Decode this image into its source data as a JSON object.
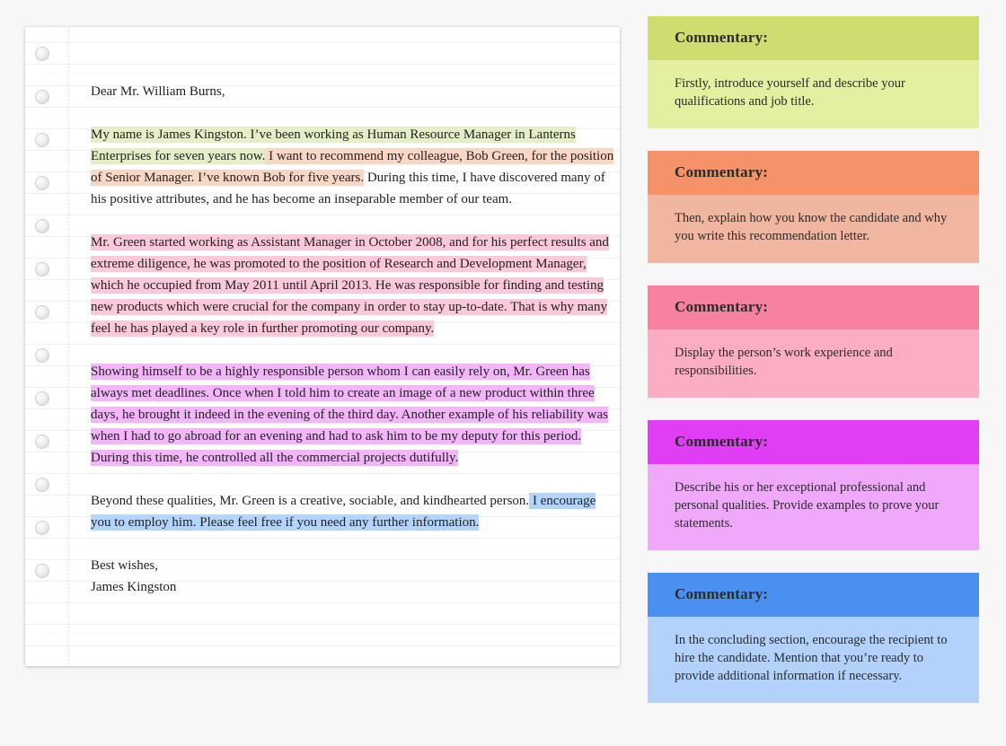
{
  "page": {
    "background": "#f7f7f8"
  },
  "paper": {
    "margin_rule_color": "#e2e2e2",
    "rule_color": "#eaf3f1",
    "hole_count": 13
  },
  "letter": {
    "salutation": "Dear Mr. William Burns,",
    "closing": "Best wishes,",
    "signature": "James Kingston",
    "lines": [
      {
        "line": 1,
        "segments": [
          {
            "text": "My name is James Kingston. I’ve been working as Human Resource Manager in Lanterns",
            "highlight": "green"
          }
        ]
      },
      {
        "line": 2,
        "segments": [
          {
            "text": "Enterprises for seven years now.",
            "highlight": "green"
          },
          {
            "text": " I want to recommend my colleague, Bob Green, for the position",
            "highlight": "peach"
          }
        ]
      },
      {
        "line": 3,
        "segments": [
          {
            "text": "of Senior Manager. I’ve known Bob for five years.",
            "highlight": "peach"
          },
          {
            "text": " During this time, I have discovered many of",
            "highlight": "none"
          }
        ]
      },
      {
        "line": 4,
        "segments": [
          {
            "text": "his positive attributes, and he has become an inseparable member of our team.",
            "highlight": "none"
          }
        ]
      },
      {
        "line": 5,
        "segments": [
          {
            "text": "Mr. Green started working as Assistant Manager in October 2008, and for his perfect results and",
            "highlight": "pink"
          }
        ]
      },
      {
        "line": 6,
        "segments": [
          {
            "text": "extreme diligence, he was promoted to the position of Research and Development Manager,",
            "highlight": "pink"
          }
        ]
      },
      {
        "line": 7,
        "segments": [
          {
            "text": "which he occupied from May 2011 until April 2013. He was responsible for finding and testing",
            "highlight": "pink"
          }
        ]
      },
      {
        "line": 8,
        "segments": [
          {
            "text": "new products which were crucial for the company in order to stay up-to-date. That is why many",
            "highlight": "pink"
          }
        ]
      },
      {
        "line": 9,
        "segments": [
          {
            "text": "feel he has played a key role in further promoting our company.",
            "highlight": "pink"
          }
        ]
      },
      {
        "line": 10,
        "segments": [
          {
            "text": "Showing himself to be a highly responsible person whom I can easily rely on, Mr. Green has",
            "highlight": "violet"
          }
        ]
      },
      {
        "line": 11,
        "segments": [
          {
            "text": "always met deadlines. Once when I told him to create an image of a new product within three",
            "highlight": "violet"
          }
        ]
      },
      {
        "line": 12,
        "segments": [
          {
            "text": "days, he brought it indeed in the evening of the third day. Another example of his reliability was",
            "highlight": "violet"
          }
        ]
      },
      {
        "line": 13,
        "segments": [
          {
            "text": "when I had to go abroad for an evening and had to ask him to be my deputy for this period.",
            "highlight": "violet"
          }
        ]
      },
      {
        "line": 14,
        "segments": [
          {
            "text": "During this time, he controlled all the commercial projects dutifully.",
            "highlight": "violet"
          }
        ]
      },
      {
        "line": 15,
        "segments": [
          {
            "text": "Beyond these qualities, Mr. Green is a creative, sociable, and kindhearted person.",
            "highlight": "none"
          },
          {
            "text": " I encourage",
            "highlight": "blue"
          }
        ]
      },
      {
        "line": 16,
        "segments": [
          {
            "text": "you to employ him. Please feel free if you need any further information.",
            "highlight": "blue"
          }
        ]
      }
    ]
  },
  "commentary": {
    "heading": "Commentary:",
    "items": [
      {
        "heading": "Commentary:",
        "text": "Firstly, introduce yourself and describe your qualifications and job title.",
        "header_color": "#cfdc6f",
        "body_color": "#e4efa0"
      },
      {
        "heading": "Commentary:",
        "text": "Then, explain how you know the candidate and why you write this recommendation letter.",
        "header_color": "#f5926a",
        "body_color": "#f0b6a0"
      },
      {
        "heading": "Commentary:",
        "text": "Display the person’s work experience and responsibilities.",
        "header_color": "#f7819f",
        "body_color": "#fcadc3"
      },
      {
        "heading": "Commentary:",
        "text": "Describe his or her exceptional professional and personal qualities. Provide examples to prove your statements.",
        "header_color": "#e03ef5",
        "body_color": "#f0a8fa"
      },
      {
        "heading": "Commentary:",
        "text": "In the concluding section, encourage the recipient to hire the candidate. Mention that you’re ready to provide additional information if necessary.",
        "header_color": "#4a90f0",
        "body_color": "#b2d1fb"
      }
    ]
  }
}
